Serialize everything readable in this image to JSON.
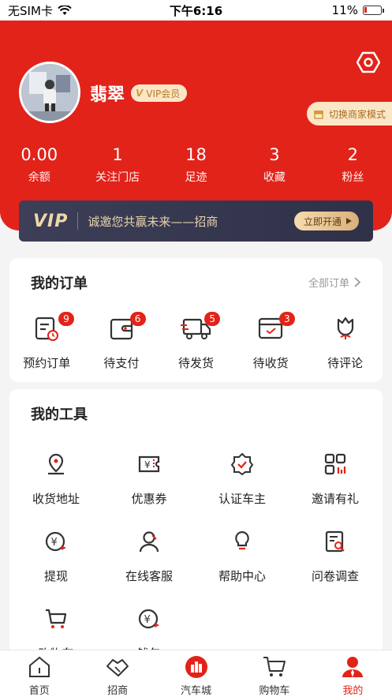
{
  "status_bar": {
    "carrier": "无SIM卡",
    "time": "下午6:16",
    "battery": "11%"
  },
  "profile": {
    "username": "翡翠",
    "vip_label": "VIP会员",
    "vip_mark": "V"
  },
  "switch_merchant": "切换商家模式",
  "stats": [
    {
      "value": "0.00",
      "label": "余额"
    },
    {
      "value": "1",
      "label": "关注门店"
    },
    {
      "value": "18",
      "label": "足迹"
    },
    {
      "value": "3",
      "label": "收藏"
    },
    {
      "value": "2",
      "label": "粉丝"
    }
  ],
  "vip_banner": {
    "logo": "VIP",
    "text": "诚邀您共赢未来——招商",
    "button": "立即开通"
  },
  "orders": {
    "title": "我的订单",
    "all_label": "全部订单",
    "items": [
      {
        "label": "预约订单",
        "badge": "9",
        "icon": "appointment-icon"
      },
      {
        "label": "待支付",
        "badge": "6",
        "icon": "wallet-icon"
      },
      {
        "label": "待发货",
        "badge": "5",
        "icon": "truck-icon"
      },
      {
        "label": "待收货",
        "badge": "3",
        "icon": "receive-box-icon"
      },
      {
        "label": "待评论",
        "badge": "",
        "icon": "flower-icon"
      }
    ]
  },
  "tools": {
    "title": "我的工具",
    "items": [
      {
        "label": "收货地址",
        "icon": "location-icon"
      },
      {
        "label": "优惠券",
        "icon": "coupon-icon"
      },
      {
        "label": "认证车主",
        "icon": "verify-badge-icon"
      },
      {
        "label": "邀请有礼",
        "icon": "invite-grid-icon"
      },
      {
        "label": "提现",
        "icon": "withdraw-icon"
      },
      {
        "label": "在线客服",
        "icon": "customer-service-icon"
      },
      {
        "label": "帮助中心",
        "icon": "help-bulb-icon"
      },
      {
        "label": "问卷调查",
        "icon": "survey-icon"
      },
      {
        "label": "购物车",
        "icon": "cart-icon"
      },
      {
        "label": "钱包",
        "icon": "wallet-yuan-icon"
      }
    ]
  },
  "tabbar": [
    {
      "label": "首页",
      "icon": "home-icon"
    },
    {
      "label": "招商",
      "icon": "handshake-icon"
    },
    {
      "label": "汽车城",
      "icon": "car-city-icon"
    },
    {
      "label": "购物车",
      "icon": "cart-icon"
    },
    {
      "label": "我的",
      "icon": "profile-icon",
      "active": true
    }
  ],
  "colors": {
    "brand_red": "#e2231a",
    "vip_gold": "#f0d7aa",
    "banner_dark": "#3c3f57"
  }
}
